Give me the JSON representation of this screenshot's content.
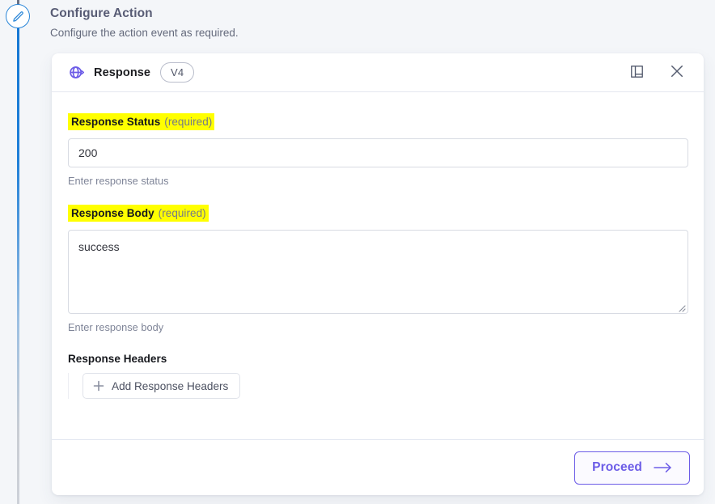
{
  "page": {
    "title": "Configure Action",
    "subtitle": "Configure the action event as required.",
    "edit_icon": "pencil-icon"
  },
  "card": {
    "header": {
      "icon": "globe-icon",
      "title": "Response",
      "version_badge": "V4",
      "notes_icon": "book-icon",
      "close_icon": "close-icon"
    },
    "fields": [
      {
        "label": "Response Status",
        "required_text": "(required)",
        "value": "200",
        "helper": "Enter response status",
        "highlight_color": "#ffff00"
      },
      {
        "label": "Response Body",
        "required_text": "(required)",
        "value": "success",
        "helper": "Enter response body",
        "highlight_color": "#ffff00"
      }
    ],
    "headers_section": {
      "title": "Response Headers",
      "add_button_label": "Add Response Headers",
      "add_button_icon": "plus-icon"
    },
    "footer": {
      "proceed_label": "Proceed",
      "proceed_icon": "arrow-right-icon",
      "accent_color": "#6c5ce7"
    }
  }
}
